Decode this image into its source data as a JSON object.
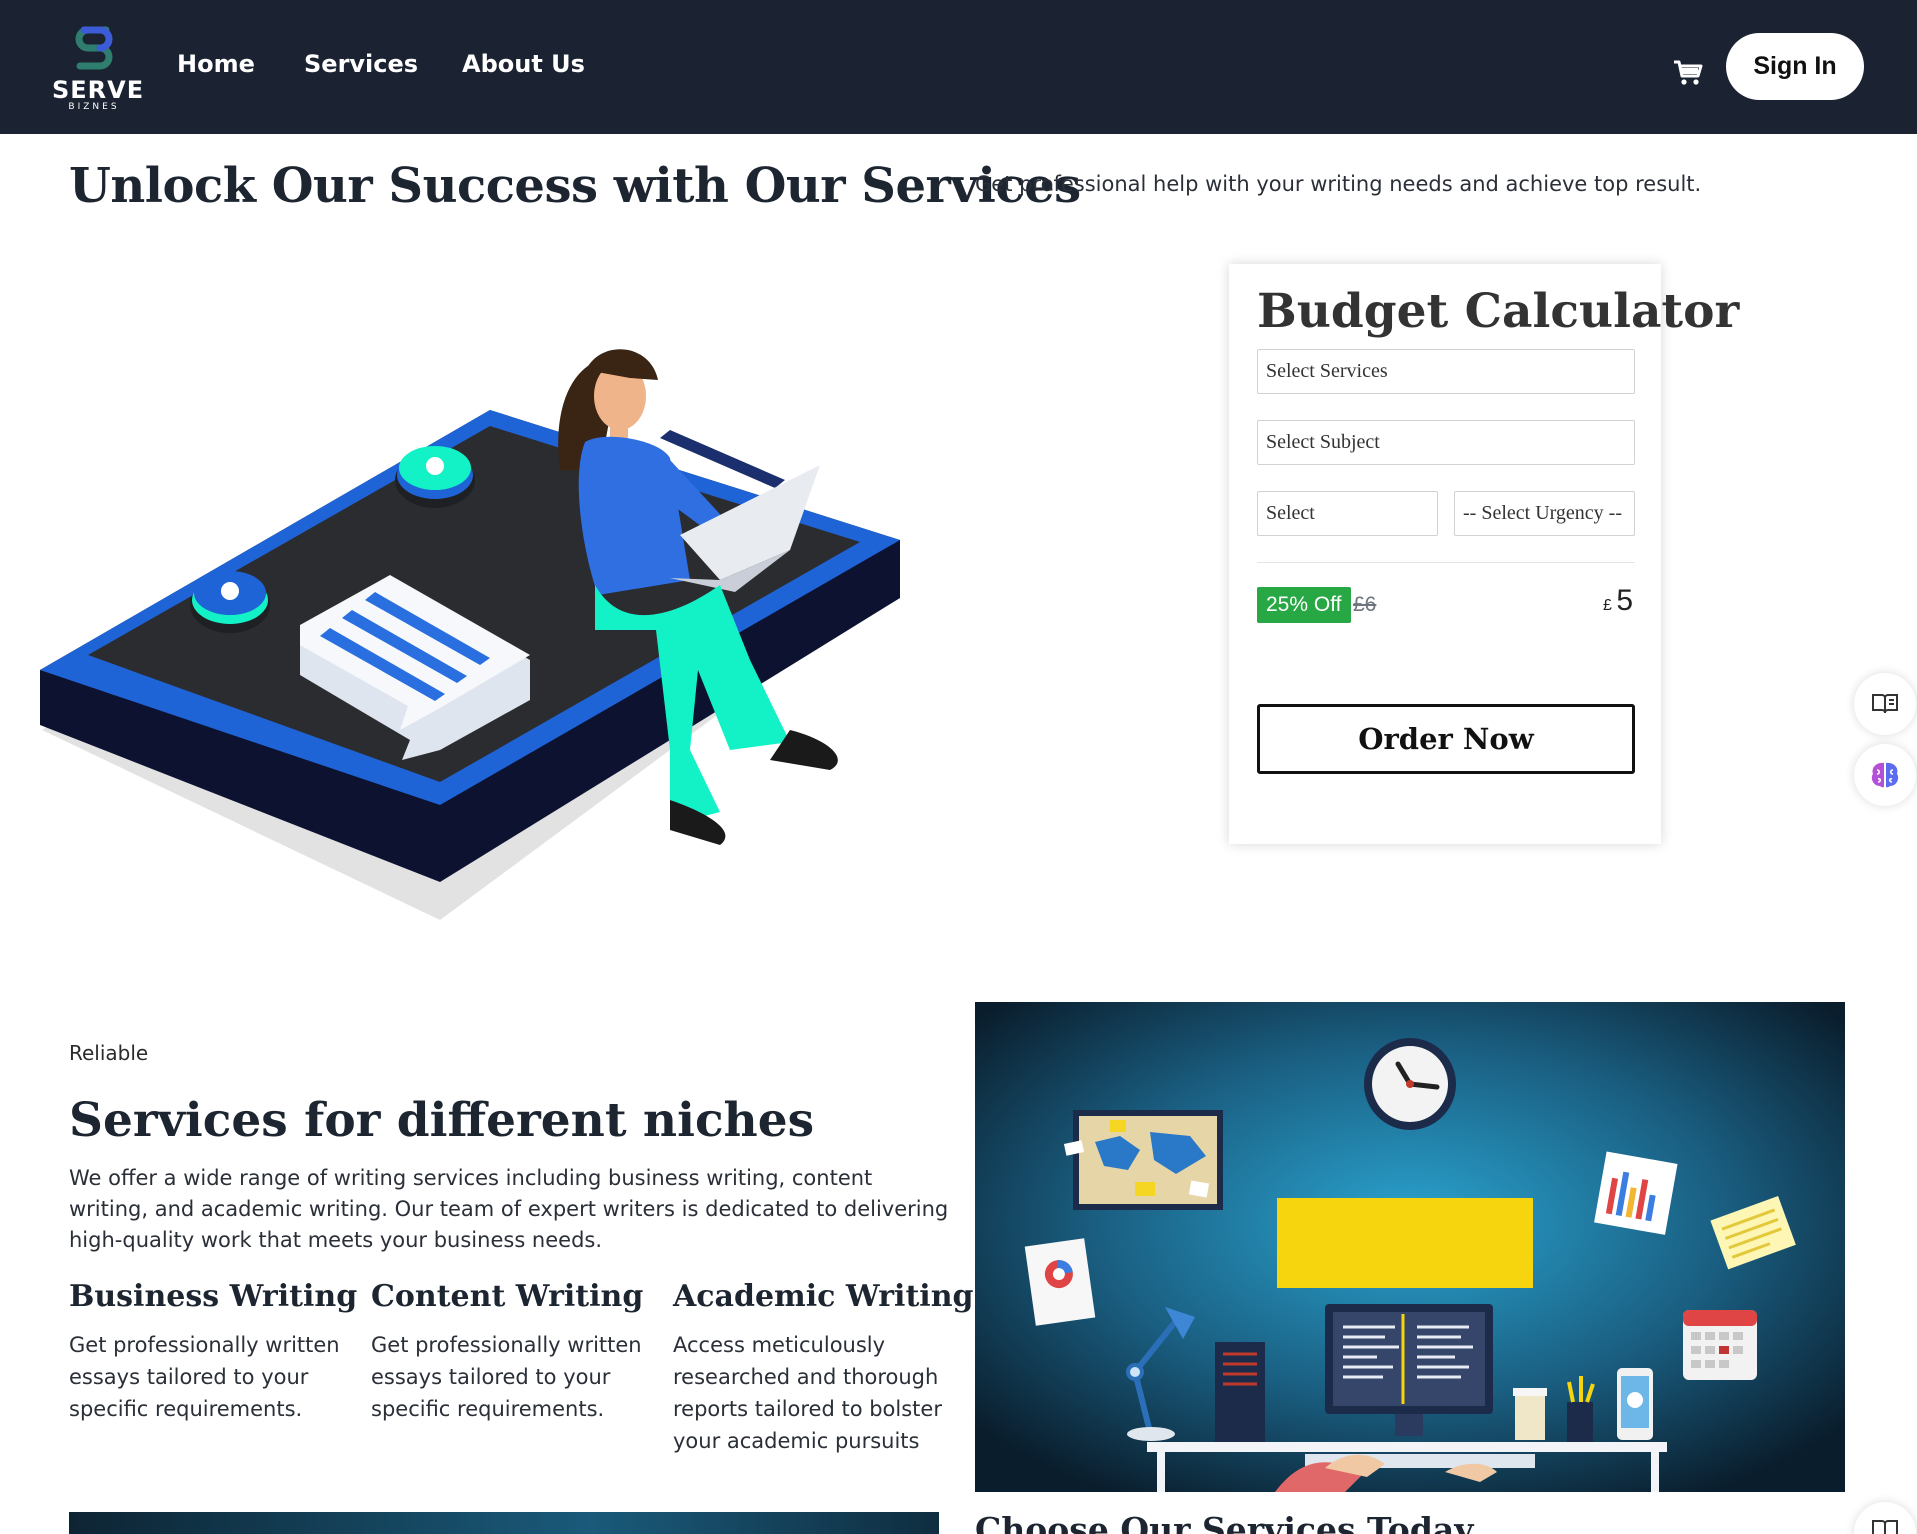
{
  "brand": {
    "name": "SERVE",
    "subtitle": "BIZNES"
  },
  "nav": {
    "links": [
      "Home",
      "Services",
      "About Us"
    ],
    "cart_icon": "cart-icon",
    "signin_label": "Sign In"
  },
  "hero": {
    "title": "Unlock Our Success with Our Services",
    "subtitle": "Get professional help with your writing needs and achieve top result."
  },
  "calculator": {
    "title": "Budget Calculator",
    "service_select": "Select Services",
    "subject_select": "Select Subject",
    "pages_select": "Select",
    "urgency_select": "-- Select Urgency --",
    "discount_badge": "25% Off",
    "old_price": "£6",
    "currency": "£",
    "price": "5",
    "order_label": "Order Now"
  },
  "side_buttons": [
    "book-open-icon",
    "brain-icon"
  ],
  "services": {
    "eyebrow": "Reliable",
    "title": "Services for different niches",
    "description": "We offer a wide range of writing services including business writing, content writing, and academic writing. Our team of expert writers is dedicated to delivering high-quality work that meets your business needs.",
    "items": [
      {
        "title": "Business Writing",
        "text": "Get professionally written essays tailored to your specific requirements."
      },
      {
        "title": "Content Writing",
        "text": "Get professionally written essays tailored to your specific requirements."
      },
      {
        "title": "Academic Writing",
        "text": "Access meticulously researched and thorough reports tailored to bolster your academic pursuits"
      }
    ]
  },
  "next_section": {
    "title": "Choose Our Services Today"
  },
  "colors": {
    "nav_bg": "#1b2231",
    "badge_green": "#28a745",
    "accent_blue": "#1f64d6",
    "mint": "#13f2c6"
  }
}
